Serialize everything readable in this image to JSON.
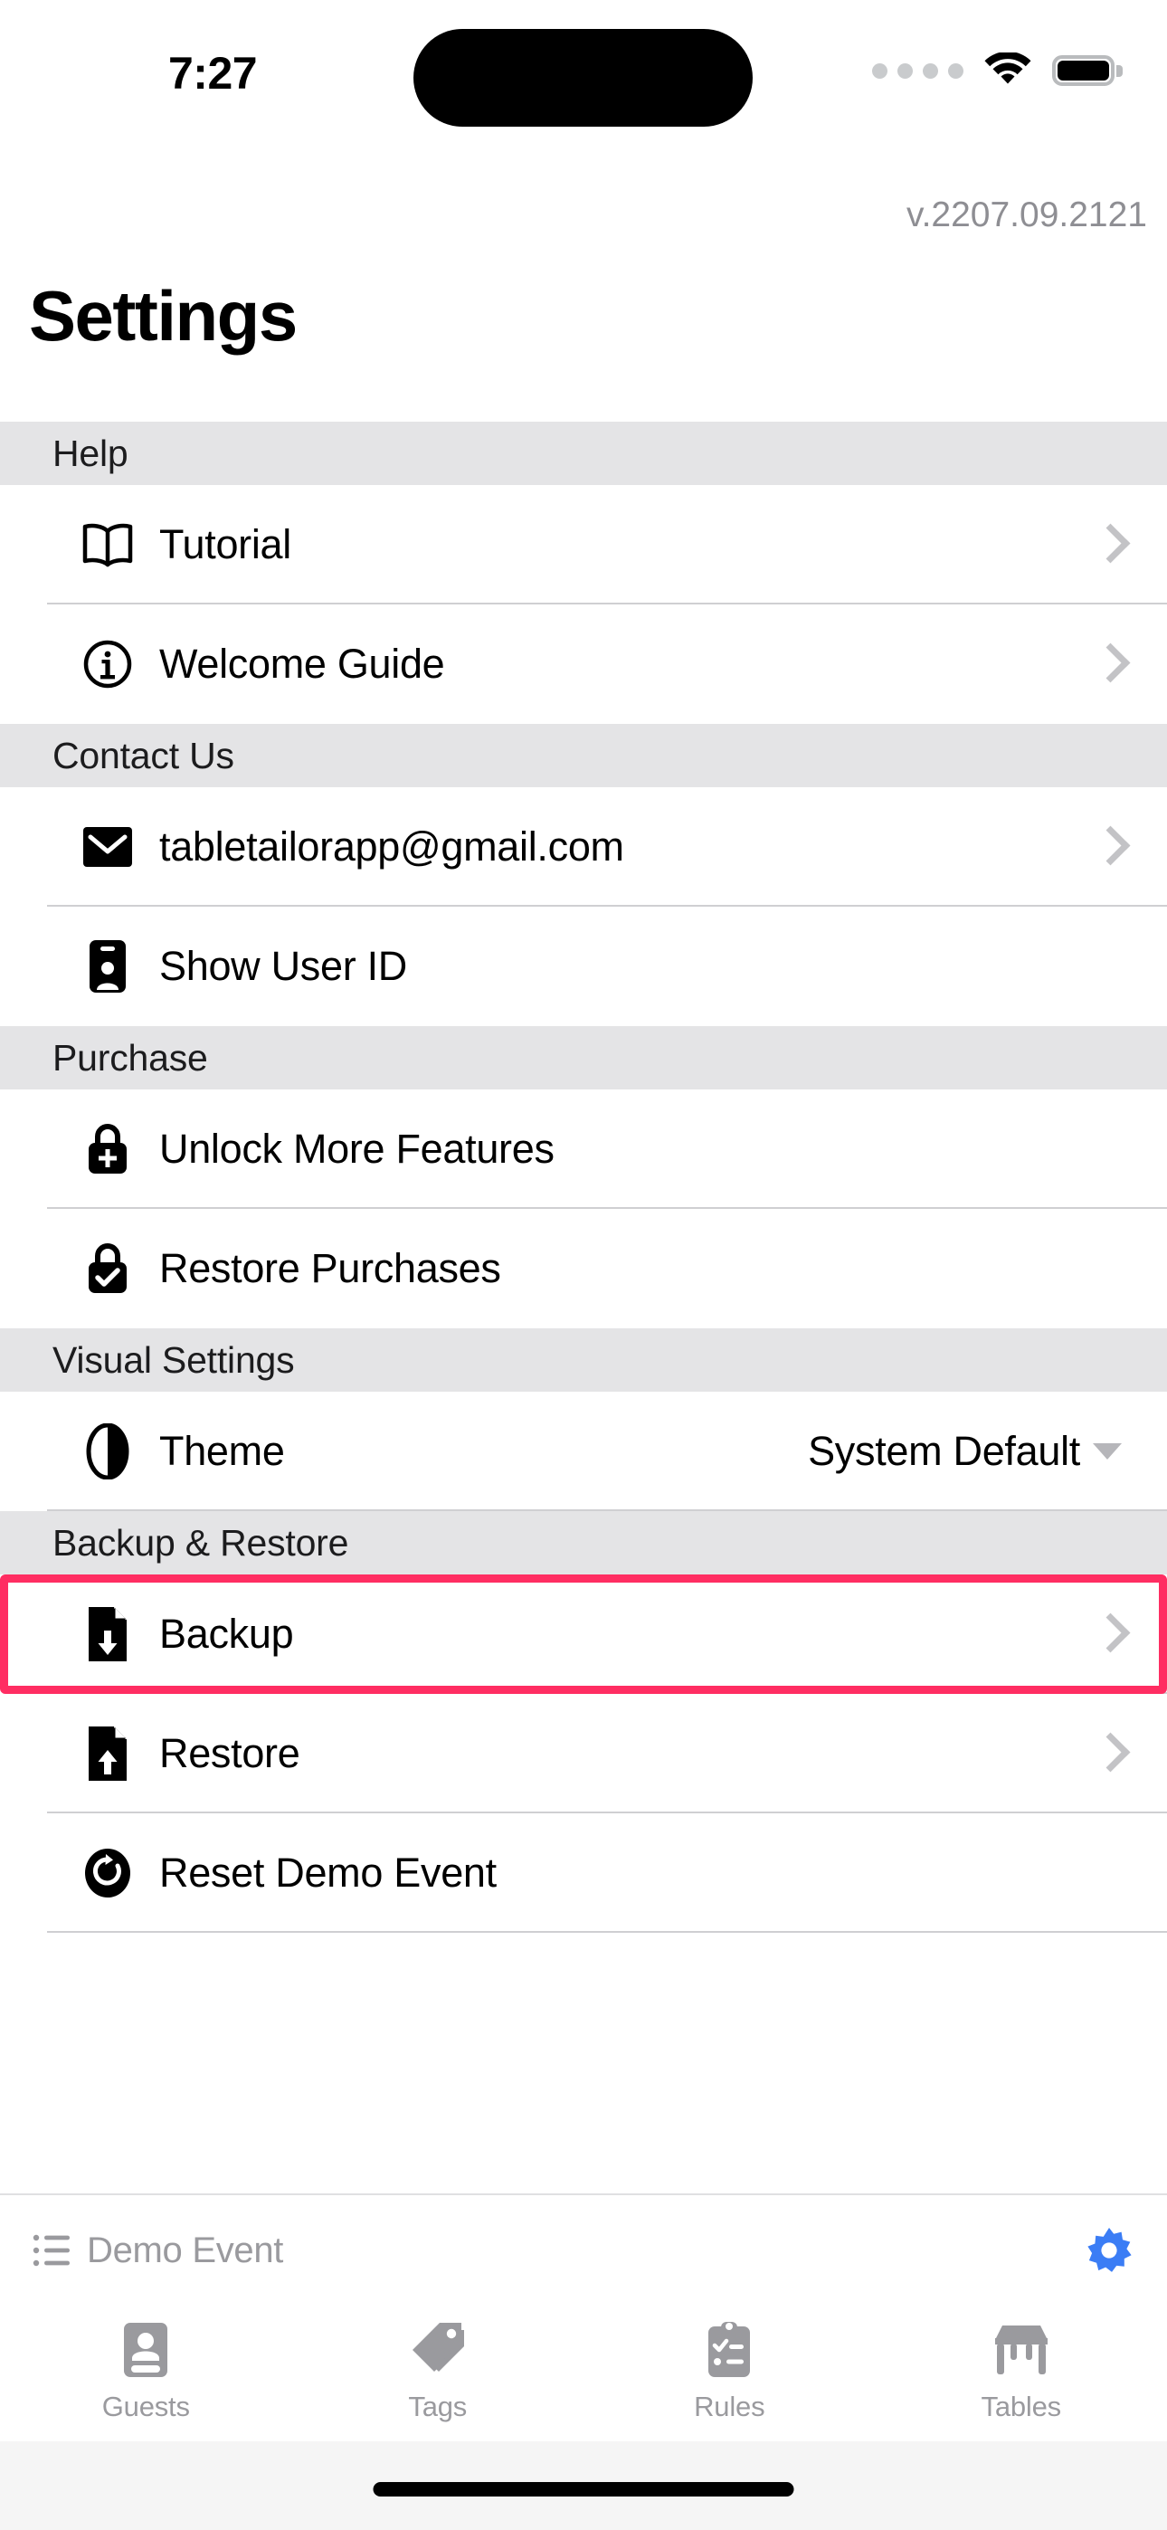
{
  "status_bar": {
    "time": "7:27",
    "cellular_icon": "cellular-dots-icon",
    "wifi_icon": "wifi-icon",
    "battery_icon": "battery-full-icon",
    "dynamic_island": "dynamic-island"
  },
  "header": {
    "version": "v.2207.09.2121",
    "title": "Settings"
  },
  "sections": [
    {
      "title": "Help",
      "rows": [
        {
          "label": "Tutorial",
          "icon": "book-icon",
          "accessory": "chevron",
          "value": ""
        },
        {
          "label": "Welcome Guide",
          "icon": "info-circle-icon",
          "accessory": "chevron",
          "value": ""
        }
      ]
    },
    {
      "title": "Contact Us",
      "rows": [
        {
          "label": "tabletailorapp@gmail.com",
          "icon": "envelope-icon",
          "accessory": "chevron",
          "value": ""
        },
        {
          "label": "Show User ID",
          "icon": "id-card-icon",
          "accessory": "none",
          "value": ""
        }
      ]
    },
    {
      "title": "Purchase",
      "rows": [
        {
          "label": "Unlock More Features",
          "icon": "lock-plus-icon",
          "accessory": "none",
          "value": ""
        },
        {
          "label": "Restore Purchases",
          "icon": "lock-check-icon",
          "accessory": "none",
          "value": ""
        }
      ]
    },
    {
      "title": "Visual Settings",
      "rows": [
        {
          "label": "Theme",
          "icon": "half-circle-icon",
          "accessory": "caret",
          "value": "System Default"
        }
      ]
    },
    {
      "title": "Backup & Restore",
      "rows": [
        {
          "label": "Backup",
          "icon": "file-download-icon",
          "accessory": "chevron",
          "value": "",
          "highlighted": true
        },
        {
          "label": "Restore",
          "icon": "file-upload-icon",
          "accessory": "chevron",
          "value": ""
        },
        {
          "label": "Reset Demo Event",
          "icon": "refresh-circle-icon",
          "accessory": "none",
          "value": ""
        }
      ]
    }
  ],
  "event_bar": {
    "list_icon": "list-bullet-icon",
    "event_name": "Demo Event",
    "settings_icon": "gear-icon"
  },
  "tab_bar": {
    "tabs": [
      {
        "label": "Guests",
        "icon": "contact-card-icon"
      },
      {
        "label": "Tags",
        "icon": "tag-icon"
      },
      {
        "label": "Rules",
        "icon": "clipboard-check-icon"
      },
      {
        "label": "Tables",
        "icon": "table-icon"
      }
    ]
  },
  "colors": {
    "highlight": "#ff2d62",
    "accent_blue": "#3b7df5",
    "section_header_bg": "#e4e4e6",
    "muted_text": "#9a9a9e",
    "chevron": "#c3c3c6"
  },
  "home_indicator": "home-indicator"
}
